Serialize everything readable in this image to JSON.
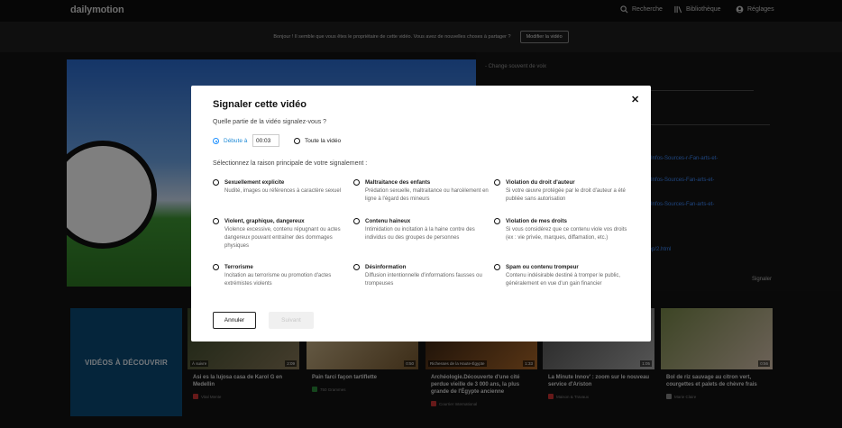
{
  "topbar": {
    "logo": "dailymotion",
    "search": "Recherche",
    "library": "Bibliothèque",
    "settings": "Réglages"
  },
  "banner": {
    "text": "Bonjour ! Il semble que vous êtes le propriétaire de cette vidéo. Vous avez de nouvelles choses à partager ?",
    "button": "Modifier la vidéo"
  },
  "side": {
    "line1": "- Change souvent de voix",
    "links": [
      "779502-Infos-Sources-r-Fan-arts-et-",
      "777678-Infos-Sources-Fan-arts-et-",
      "779532-Infos-Sources-Fan-arts-et-",
      "/pages/ep/2.html"
    ],
    "report": "Signaler"
  },
  "gallery": {
    "discover": "VIDÉOS À DÉCOUVRIR",
    "cards": [
      {
        "title": "Asi es la lujosa casa de Karol G en Medellin",
        "channel": "Vital Mente",
        "duration": "2:09",
        "badge": "À suivre"
      },
      {
        "title": "Pain farci façon tartiflette",
        "channel": "750 Grammes",
        "duration": "0:50",
        "badge": ""
      },
      {
        "title": "Archéologie.Découverte d'une cité perdue vieille de 3 000 ans, la plus grande de l'Égypte ancienne",
        "channel": "Courrier International",
        "duration": "1:33",
        "badge": "Richesses de la Haute-Égypte"
      },
      {
        "title": "La Minute Innov' : zoom sur le nouveau service d'Ariston",
        "channel": "Maison & Travaux",
        "duration": "1:05",
        "badge": ""
      },
      {
        "title": "Bol de riz sauvage au citron vert, courgettes et palets de chèvre frais",
        "channel": "Marie Claire",
        "duration": "0:56",
        "badge": ""
      }
    ]
  },
  "modal": {
    "title": "Signaler cette vidéo",
    "question": "Quelle partie de la vidéo signalez-vous ?",
    "start_label": "Débute à",
    "start_time": "00:03",
    "whole_label": "Toute la vidéo",
    "reason_question": "Sélectionnez la raison principale de votre signalement :",
    "options": [
      {
        "title": "Sexuellement explicite",
        "desc": "Nudité, images ou références à caractère sexuel"
      },
      {
        "title": "Maltraitance des enfants",
        "desc": "Prédation sexuelle, maltraitance ou harcèlement en ligne à l'égard des mineurs"
      },
      {
        "title": "Violation du droit d'auteur",
        "desc": "Si votre œuvre protégée par le droit d'auteur a été publiée sans autorisation"
      },
      {
        "title": "Violent, graphique, dangereux",
        "desc": "Violence excessive, contenu répugnant ou actes dangereux pouvant entraîner des dommages physiques"
      },
      {
        "title": "Contenu haineux",
        "desc": "Intimidation ou incitation à la haine contre des individus ou des groupes de personnes"
      },
      {
        "title": "Violation de mes droits",
        "desc": "Si vous considérez que ce contenu viole vos droits (ex : vie privée, marques, diffamation, etc.)"
      },
      {
        "title": "Terrorisme",
        "desc": "Incitation au terrorisme ou promotion d'actes extrémistes violents"
      },
      {
        "title": "Désinformation",
        "desc": "Diffusion intentionnelle d'informations fausses ou trompeuses"
      },
      {
        "title": "Spam ou contenu trompeur",
        "desc": "Contenu indésirable destiné à tromper le public, généralement en vue d'un gain financier"
      }
    ],
    "cancel": "Annuler",
    "next": "Suivant"
  }
}
